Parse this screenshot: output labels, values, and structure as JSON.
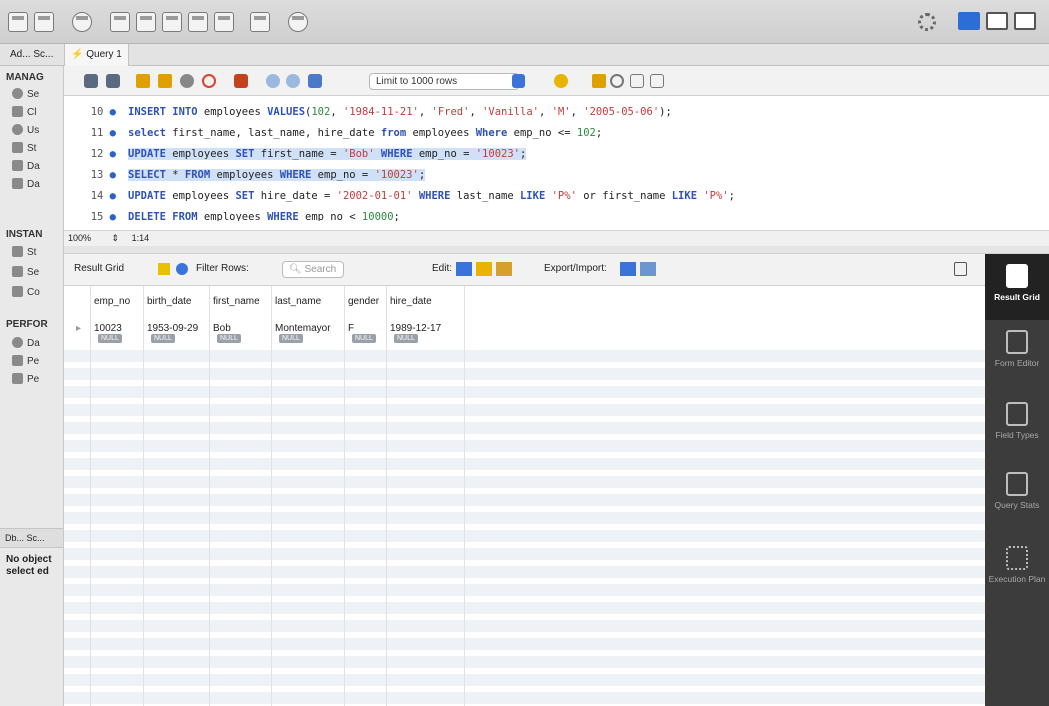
{
  "tabs": [
    {
      "label": "Ad... Sc..."
    },
    {
      "label": "Query 1"
    }
  ],
  "sidebar": {
    "management_header": "MANAG",
    "management_items": [
      "Se",
      "Cl",
      "Us",
      "St",
      "Da",
      "Da"
    ],
    "instance_header": "INSTAN",
    "instance_items": [
      "St",
      "Se",
      "Co"
    ],
    "performance_header": "PERFOR",
    "performance_items": [
      "Da",
      "Pe",
      "Pe"
    ],
    "db_tab": "Db... Sc...",
    "object_info": "No object select ed"
  },
  "editor": {
    "limit_label": "Limit to 1000 rows",
    "zoom": "100%",
    "cursor_pos": "1:14",
    "lines": [
      {
        "num": "10",
        "text": "INSERT INTO employees VALUES(102, '1984-11-21', 'Fred', 'Vanilla', 'M', '2005-05-06');",
        "selected": false
      },
      {
        "num": "11",
        "text": "select first_name, last_name, hire_date from employees Where emp_no <= 102;",
        "selected": false
      },
      {
        "num": "12",
        "text": "UPDATE employees SET first_name = 'Bob' WHERE emp_no = '10023';",
        "selected": true
      },
      {
        "num": "13",
        "text": "SELECT * FROM employees WHERE emp_no = '10023';",
        "selected": true
      },
      {
        "num": "14",
        "text": "UPDATE employees SET hire_date = '2002-01-01' WHERE last_name LIKE 'P%' or first_name LIKE 'P%';",
        "selected": false
      },
      {
        "num": "15",
        "text": "DELETE FROM employees WHERE emp_no < 10000;",
        "selected": false
      }
    ]
  },
  "result_toolbar": {
    "result_grid_label": "Result Grid",
    "filter_rows_label": "Filter Rows:",
    "search_placeholder": "Search",
    "edit_label": "Edit:",
    "export_import_label": "Export/Import:"
  },
  "grid": {
    "columns": [
      "emp_no",
      "birth_date",
      "first_name",
      "last_name",
      "gender",
      "hire_date"
    ],
    "rows": [
      [
        "10023",
        "1953-09-29",
        "Bob",
        "Montemayor",
        "F",
        "1989-12-17"
      ]
    ],
    "null_label": "NULL"
  },
  "right_panel": [
    {
      "label": "Result Grid",
      "active": true
    },
    {
      "label": "Form Editor",
      "active": false
    },
    {
      "label": "Field Types",
      "active": false
    },
    {
      "label": "Query Stats",
      "active": false
    },
    {
      "label": "Execution Plan",
      "active": false
    }
  ],
  "colors": {
    "selection": "#cfe0f7",
    "keyword": "#2f52b8",
    "string": "#c43c3c",
    "accent": "#2d6dd8"
  }
}
